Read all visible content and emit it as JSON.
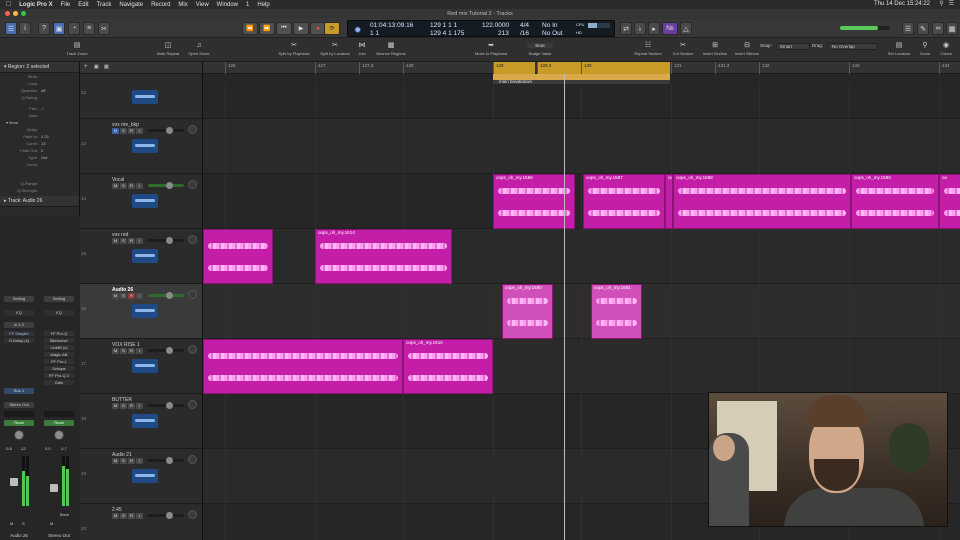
{
  "menubar": {
    "app": "Logic Pro X",
    "items": [
      "File",
      "Edit",
      "Track",
      "Navigate",
      "Record",
      "Mix",
      "View",
      "Window",
      "1",
      "Help"
    ],
    "clock": "Thu 14 Dec  15:24:22"
  },
  "window": {
    "title": "Red mix Tutorial 2 - Tracks"
  },
  "lcd": {
    "smpte": "01:04:13:09.16",
    "bars_top": "129  1  1  1",
    "bars_bottom": "129  4  1  175",
    "tempo": "122.0000",
    "tempo_sub": "213",
    "signature": "4/4",
    "division": "/16",
    "in": "No In",
    "out": "No Out",
    "cpu_label": "CPU",
    "hd_label": "HD",
    "bottom_left": "1      1"
  },
  "toolbar": {
    "tools": [
      "Track Zoom",
      "Note Repeat",
      "Open Score",
      "Split by Playhead",
      "Split by Locators",
      "Join",
      "Bounce Regions",
      "Move to Playhead",
      "Nudge Value",
      "Repeat Section",
      "Cut Section",
      "Insert Section",
      "Insert Silence",
      "Set Locators",
      "Zoom",
      "Colors"
    ],
    "nudge_value": "Beat",
    "edit": "Edit",
    "functions": "Functions",
    "view": "View",
    "snap_label": "Snap:",
    "snap_value": "Smart",
    "drag_label": "Drag:",
    "drag_value": "No Overlap"
  },
  "inspector": {
    "region_header": "Region: 2 selected",
    "rows": [
      {
        "k": "Mute:",
        "v": ""
      },
      {
        "k": "Loop:",
        "v": ""
      },
      {
        "k": "Quantize:",
        "v": "off"
      },
      {
        "k": "Q-Swing:",
        "v": ""
      },
      {
        "k": "Flex:",
        "v": "✓"
      },
      {
        "k": "Gain:",
        "v": ""
      }
    ],
    "more_header": "More",
    "more_rows": [
      {
        "k": "Delay:",
        "v": ""
      },
      {
        "k": "Fade In:",
        "v": "2  22"
      },
      {
        "k": "Curve:",
        "v": "13"
      },
      {
        "k": "Fade Out:",
        "v": "2"
      },
      {
        "k": "Type:",
        "v": "Out"
      },
      {
        "k": "Curve:",
        "v": ""
      },
      {
        "k": "Q-Range:",
        "v": ""
      },
      {
        "k": "Q-Strength:",
        "v": ""
      }
    ],
    "track_header": "Track:  Audio 26"
  },
  "strips": {
    "left": {
      "setting": "Setting",
      "eq": "EQ",
      "input": "In 1-2",
      "plugins": [
        "FF Simpler",
        "H-Delay (s)"
      ],
      "send": "Bus 1",
      "output": "Stereo Out",
      "read": "Read",
      "value_a": "-5.6",
      "value_b": "-12",
      "name": "Audio 26"
    },
    "right": {
      "setting": "Setting",
      "eq": "EQ",
      "plugins": [
        "FF Pro-Q",
        "Bitcrusher",
        "LinMB (s)",
        "Magic AB",
        "FF Pro-L",
        "Schope",
        "FF Pro-Q 2",
        "Gain"
      ],
      "read": "Read",
      "value_a": "0.0",
      "value_b": "-4.7",
      "bnce": "Bnce",
      "name": "Stereo Out"
    }
  },
  "tracks": [
    {
      "num": "12",
      "name": ""
    },
    {
      "num": "13",
      "name": "vox me_bkp"
    },
    {
      "num": "14",
      "name": "Vocal"
    },
    {
      "num": "15",
      "name": "vox red"
    },
    {
      "num": "16",
      "name": "Audio 26"
    },
    {
      "num": "17",
      "name": "VOX RISE 1"
    },
    {
      "num": "18",
      "name": "BUTTER"
    },
    {
      "num": "19",
      "name": "Audio 21"
    },
    {
      "num": "20",
      "name": "2.45"
    }
  ],
  "track_buttons": {
    "m": "M",
    "s": "S",
    "r": "R",
    "i": "I"
  },
  "ruler": [
    "126",
    "127",
    "127.3",
    "128",
    "129",
    "129.3",
    "130",
    "131",
    "131.3",
    "132",
    "133",
    "134"
  ],
  "marker": {
    "name": "main breakdown"
  },
  "regions": {
    "r14a": "oops_oh_my.1586",
    "r14b": "oops_oh_my.1587",
    "r14c": "oo",
    "r14d": "oops_oh_my.1588",
    "r14e": "oops_oh_my.1590",
    "r14f": "oo",
    "r15b": "oops_oh_my.1614",
    "r16a": "oops_oh_my.1680",
    "r16b": "oops_oh_my.1681",
    "r17b": "oops_oh_my.1616"
  }
}
